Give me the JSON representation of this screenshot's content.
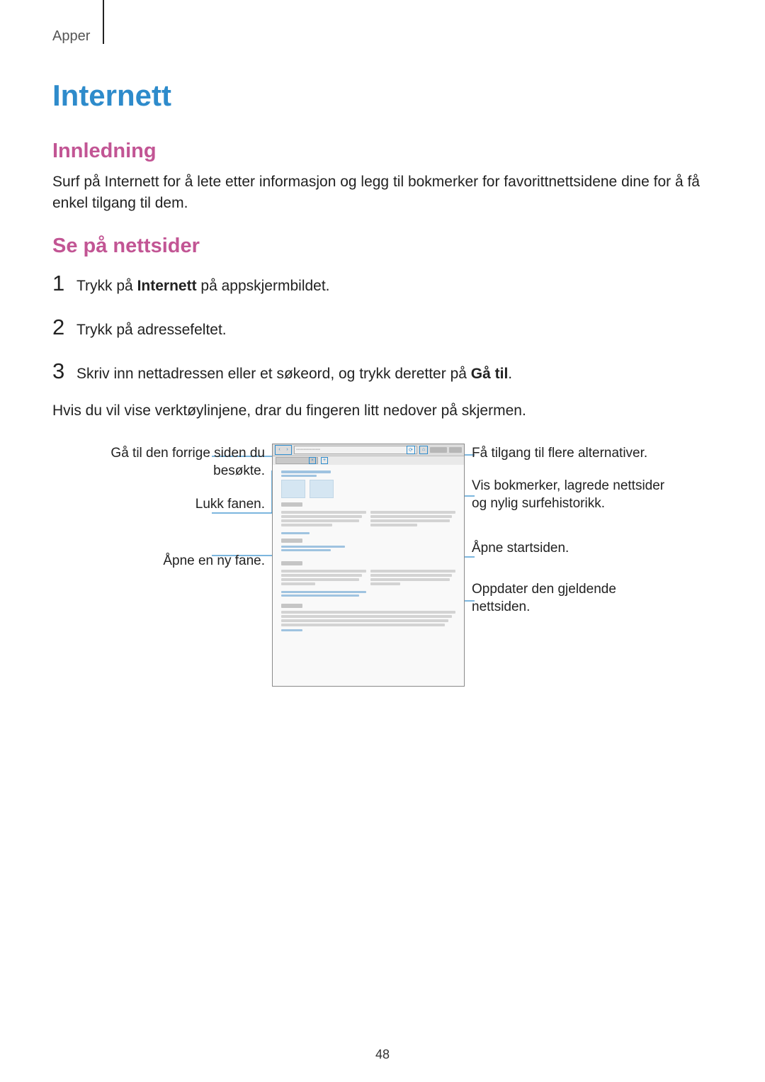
{
  "header": {
    "section_label": "Apper"
  },
  "page_title": "Internett",
  "intro": {
    "heading": "Innledning",
    "body": "Surf på Internett for å lete etter informasjon og legg til bokmerker for favorittnettsidene dine for å få enkel tilgang til dem."
  },
  "browse": {
    "heading": "Se på nettsider",
    "steps": [
      {
        "num": "1",
        "before": "Trykk på ",
        "bold": "Internett",
        "after": " på appskjermbildet."
      },
      {
        "num": "2",
        "before": "Trykk på adressefeltet.",
        "bold": "",
        "after": ""
      },
      {
        "num": "3",
        "before": "Skriv inn nettadressen eller et søkeord, og trykk deretter på ",
        "bold": "Gå til",
        "after": "."
      }
    ],
    "subnote": "Hvis du vil vise verktøylinjene, drar du fingeren litt nedover på skjermen."
  },
  "callouts_left": [
    "Gå til den forrige siden du besøkte.",
    "Lukk fanen.",
    "Åpne en ny fane."
  ],
  "callouts_right": [
    "Få tilgang til flere alternativer.",
    "Vis bokmerker, lagrede nettsider og nylig surfehistorikk.",
    "Åpne startsiden.",
    "Oppdater den gjeldende nettsiden."
  ],
  "page_number": "48"
}
